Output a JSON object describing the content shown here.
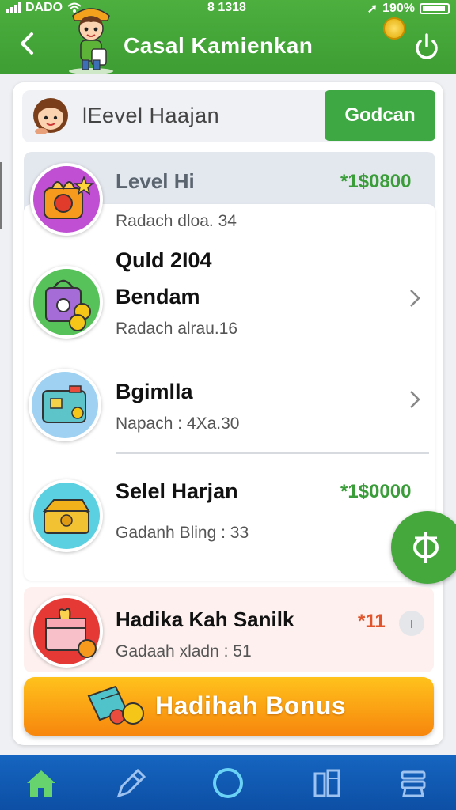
{
  "status_bar": {
    "carrier": "DADO",
    "time": "8 1318",
    "battery": "190%"
  },
  "header": {
    "title": "Casal Kamienkan",
    "icons": {
      "back": "arrow-left-icon",
      "power": "power-icon",
      "coin": "coin-icon"
    }
  },
  "search_row": {
    "text": "lEevel Haajan",
    "button_label": "Godcan"
  },
  "list": [
    {
      "title": "Level Hi",
      "subtitle": "Radach dloa. 34",
      "reward": "*1$0800",
      "icon": "gift-bag-icon"
    },
    {
      "title_line1": "Quld 2I04",
      "title_line2": "Bendam",
      "subtitle": "Radach alrau.16",
      "icon": "shopping-bag-icon"
    },
    {
      "title": "Bgimlla",
      "subtitle": "Napach : 4Xa.30",
      "icon": "wallet-icon"
    },
    {
      "title": "Selel Harjan",
      "subtitle": "Gadanh Bling : 33",
      "reward": "*1$0000",
      "icon": "treasure-chest-icon"
    }
  ],
  "special_item": {
    "title": "Hadika Kah Sanilk",
    "subtitle": "Gadaah xladn : 51",
    "reward": "*11",
    "info": "ı",
    "icon": "gift-box-icon"
  },
  "bonus_button": {
    "label": "Hadihah Bonus"
  },
  "fab": {
    "icon": "currency-icon"
  },
  "bottom_nav": [
    "home-icon",
    "edit-icon",
    "circle-icon",
    "books-icon",
    "settings-icon"
  ],
  "colors": {
    "header": "#43a838",
    "accent_green": "#3ea843",
    "nav": "#1565c0",
    "bonus": "#f7a01a",
    "reward_green": "#3a9d3a",
    "reward_orange": "#e2552c"
  }
}
